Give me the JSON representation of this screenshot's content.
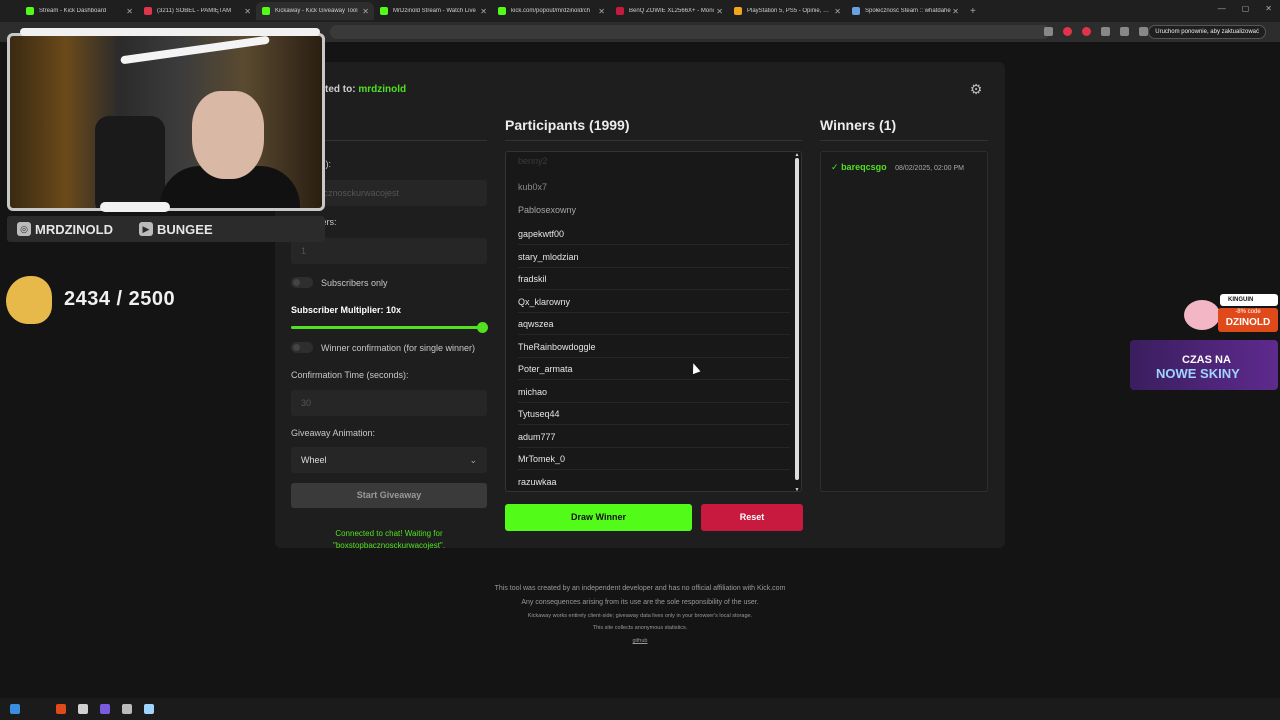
{
  "browser": {
    "tabs": [
      {
        "title": "Stream - Kick Dashboard",
        "color": "#53fc18",
        "active": false
      },
      {
        "title": "(3211) SOBEL - PAMIĘTAM",
        "color": "#e0344a",
        "active": false
      },
      {
        "title": "Kickaway - Kick Giveaway Tool",
        "color": "#53fc18",
        "active": true
      },
      {
        "title": "MrDzinold Stream - Watch Live",
        "color": "#53fc18",
        "active": false
      },
      {
        "title": "kick.com/popout/mrdzinold/ch",
        "color": "#53fc18",
        "active": false
      },
      {
        "title": "BenQ ZOWIE XL2566X+ - Moni",
        "color": "#c8193e",
        "active": false
      },
      {
        "title": "PlayStation 5, PS5 - Opinie, Cen",
        "color": "#f3a51b",
        "active": false
      },
      {
        "title": "Społeczność Steam :: whatdahe",
        "color": "#6aa0e0",
        "active": false
      }
    ],
    "update_label": "Uruchom ponownie, aby zaktualizować"
  },
  "header": {
    "connected_prefix": "ted to: ",
    "channel": "mrdzinold"
  },
  "settings": {
    "title": "ngs",
    "keyword_label": "(optional):",
    "keyword_value": "topbacznosckurwacojest",
    "winners_label": "of Winners:",
    "winners_value": "1",
    "subs_only_label": "Subscribers only",
    "multiplier_label": "Subscriber Multiplier: 10x",
    "multiplier_value": 10,
    "multiplier_fraction": 1.0,
    "confirm_label": "Winner confirmation (for single winner)",
    "confirm_time_label": "Confirmation Time (seconds):",
    "confirm_time_value": "30",
    "animation_label": "Giveaway Animation:",
    "animation_value": "Wheel",
    "start_label": "Start Giveaway",
    "status_line1": "Connected to chat! Waiting for",
    "status_line2": "\"boxstopbacznosckurwacojest\"."
  },
  "participants": {
    "title": "Participants (1999)",
    "items": [
      "benny2",
      "kub0x7",
      "Pablosexowny",
      "gapekwtf00",
      "stary_mlodzian",
      "fradskil",
      "Qx_klarowny",
      "aqwszea",
      "TheRainbowdoggle",
      "Poter_armata",
      "michao",
      "Tytuseq44",
      "adum777",
      "MrTomek_0",
      "razuwkaa"
    ],
    "draw_label": "Draw Winner",
    "reset_label": "Reset"
  },
  "winners": {
    "title": "Winners (1)",
    "items": [
      {
        "check": "✓",
        "name": "bareqcsgo",
        "time": "08/02/2025, 02:00 PM"
      }
    ]
  },
  "footer": {
    "line1": "This tool was created by an independent developer and has no official affiliation with Kick.com",
    "line2": "Any consequences arising from its use are the sole responsibility of the user.",
    "line3": "Kickaway works entirely client-side; giveaway data lives only in your browser's local storage.",
    "line4": "This site collects anonymous statistics.",
    "github": "github"
  },
  "overlay": {
    "social1": "MRDZINOLD",
    "social2": "BUNGEE",
    "counter": "2434 / 2500",
    "promo_brand": "KINGUIN",
    "promo_discount": "-8% code",
    "promo_code": "DZINOLD",
    "promo2_line1": "CZAS NA",
    "promo2_line2": "NOWE SKINY"
  }
}
